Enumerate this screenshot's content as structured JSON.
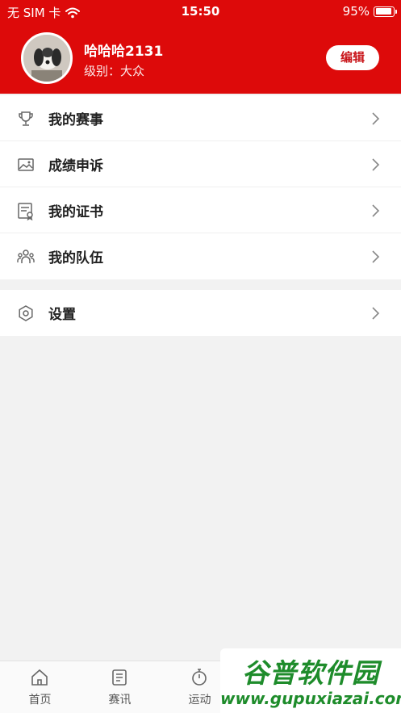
{
  "status_bar": {
    "carrier": "无 SIM 卡",
    "time": "15:50",
    "battery": "95%",
    "battery_level": 0.95
  },
  "profile": {
    "username": "哈哈哈2131",
    "level": "级别：大众",
    "edit_label": "编辑"
  },
  "menu_main": [
    {
      "label": "我的赛事",
      "icon": "trophy-icon"
    },
    {
      "label": "成绩申诉",
      "icon": "image-icon"
    },
    {
      "label": "我的证书",
      "icon": "certificate-icon"
    },
    {
      "label": "我的队伍",
      "icon": "team-icon"
    }
  ],
  "menu_settings": [
    {
      "label": "设置",
      "icon": "settings-icon"
    }
  ],
  "tabbar": [
    {
      "label": "首页",
      "icon": "home-icon"
    },
    {
      "label": "赛讯",
      "icon": "news-icon"
    },
    {
      "label": "运动",
      "icon": "stopwatch-icon"
    }
  ],
  "watermark": {
    "title": "谷普软件园",
    "url": "www.gupuxiazai.com"
  },
  "colors": {
    "accent": "#dd0a0a",
    "background": "#f2f2f2"
  }
}
